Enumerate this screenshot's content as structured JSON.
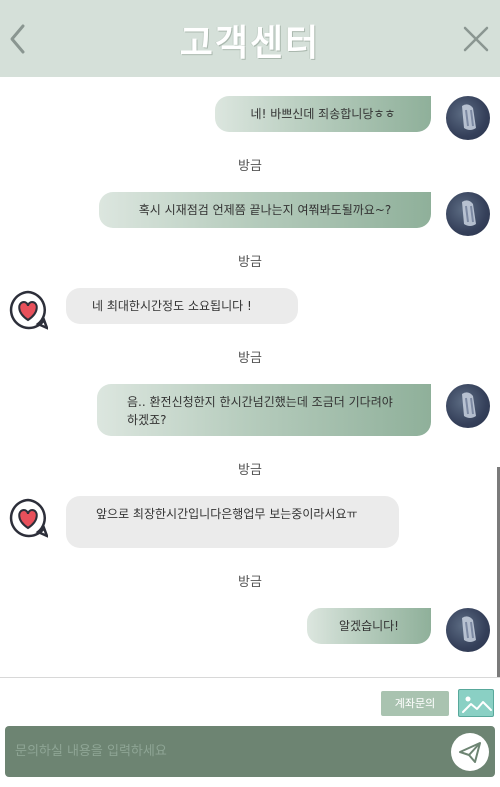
{
  "header": {
    "title": "고객센터"
  },
  "messages": [
    {
      "side": "user",
      "text": "네! 바쁘신데 죄송합니당ㅎㅎ",
      "time": "방금"
    },
    {
      "side": "user",
      "text": "혹시 시재점검 언제쯤 끝나는지 여쭤봐도될까요~?",
      "time": "방금"
    },
    {
      "side": "agent",
      "text": "네 최대한시간정도 소요됩니다 !",
      "time": "방금"
    },
    {
      "side": "user",
      "text": "음.. 환전신청한지 한시간넘긴했는데 조금더 기다려야하겠죠?",
      "time": "방금"
    },
    {
      "side": "agent",
      "text": "앞으로 최장한시간입니다은행업무 보는중이라서요ㅠ",
      "time": "방금"
    },
    {
      "side": "user",
      "text": "알겠습니다!"
    }
  ],
  "bottom": {
    "account_inquiry_label": "계좌문의",
    "input_placeholder": "문의하실 내용을 입력하세요"
  },
  "icons": {
    "back": "chevron-left-icon",
    "close": "close-icon",
    "image": "image-icon",
    "send": "paper-plane-icon",
    "agent_avatar": "heart-chat-icon"
  },
  "colors": {
    "header_bg": "#d5e0d9",
    "bubble_out_end": "#8fb09a",
    "bubble_in": "#ebebeb",
    "input_bg": "#6d8472",
    "account_btn": "#a9c3b0",
    "image_btn": "#8ad0c4"
  }
}
